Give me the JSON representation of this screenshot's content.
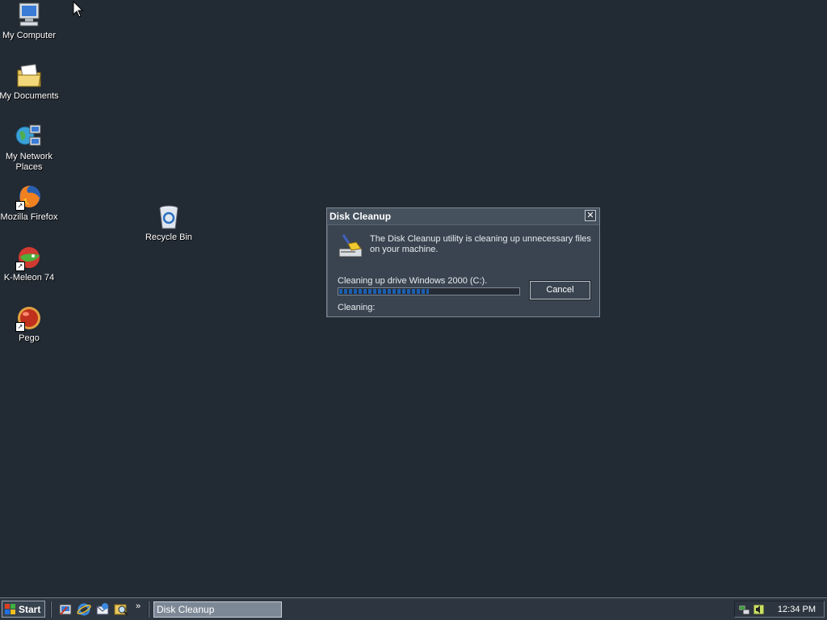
{
  "desktop": {
    "icons": [
      {
        "label": "My Computer",
        "icon": "my-computer-icon"
      },
      {
        "label": "My Documents",
        "icon": "my-documents-icon"
      },
      {
        "label_line1": "My Network",
        "label_line2": "Places",
        "icon": "network-places-icon"
      },
      {
        "label": "Mozilla Firefox",
        "icon": "firefox-icon",
        "shortcut": true
      },
      {
        "label": "K-Meleon 74",
        "icon": "k-meleon-icon",
        "shortcut": true
      },
      {
        "label": "Pego",
        "icon": "pego-icon",
        "shortcut": true
      },
      {
        "label": "Recycle Bin",
        "icon": "recycle-bin-icon"
      }
    ]
  },
  "dialog": {
    "title": "Disk Cleanup",
    "close_glyph": "✕",
    "message": "The Disk Cleanup utility is cleaning up unnecessary files on your machine.",
    "drive_label": "Cleaning up drive Windows 2000 (C:).",
    "progress_percent": 50,
    "cancel_label": "Cancel",
    "status": "Cleaning:"
  },
  "taskbar": {
    "start_label": "Start",
    "quick_launch": [
      "show-desktop-icon",
      "internet-explorer-icon",
      "outlook-express-icon",
      "search-icon"
    ],
    "more_glyph": "»",
    "task_button": "Disk Cleanup",
    "tray_icons": [
      "network-icon",
      "volume-icon"
    ],
    "clock": "12:34 PM"
  },
  "colors": {
    "desktop": "#222a33",
    "dialog_bg": "#3a4450",
    "progress_fill": "#1d5fb0",
    "taskbar": "#2d3640"
  }
}
